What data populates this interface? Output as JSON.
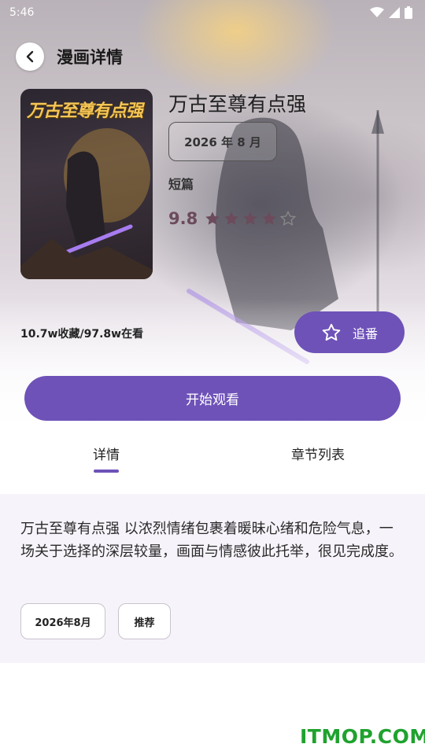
{
  "status_bar": {
    "time": "5:46"
  },
  "header": {
    "title": "漫画详情"
  },
  "comic": {
    "cover_text": "万古至尊有点强",
    "title": "万古至尊有点强",
    "date": "2026 年 8 月",
    "genre": "短篇",
    "rating": "9.8",
    "stars_filled": 4,
    "stars_total": 5,
    "stats": "10.7w收藏/97.8w在看"
  },
  "actions": {
    "follow_label": "追番",
    "watch_label": "开始观看"
  },
  "tabs": [
    {
      "label": "详情",
      "active": true
    },
    {
      "label": "章节列表",
      "active": false
    }
  ],
  "detail": {
    "description": "万古至尊有点强 以浓烈情绪包裹着暖昧心绪和危险气息，一场关于选择的深层较量，画面与情感彼此托举，很见完成度。",
    "tags": [
      "2026年8月",
      "推荐"
    ]
  },
  "watermark": "ITMOP.COM",
  "colors": {
    "accent": "#6e52b8",
    "rating": "#6b4b5c",
    "panel_bg": "#f7f3fa",
    "watermark": "#1fa22e"
  }
}
